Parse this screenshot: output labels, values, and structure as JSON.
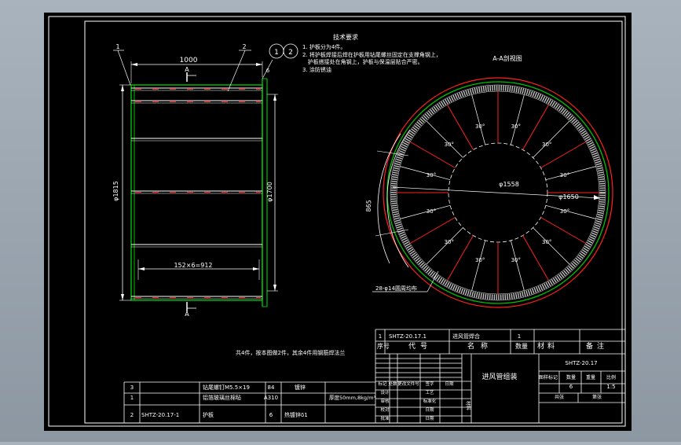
{
  "colors": {
    "background": "#9aa5b0",
    "sheet": "#000000",
    "line": "#ffffff",
    "shell": "#00c000",
    "hidden": "#ff2020",
    "insulation": "#c8c8c8"
  },
  "tech_requirements": {
    "heading": "技术要求",
    "lines": [
      "1. 护板分为4件。",
      "2. 将护板焊接后焊在护板用钻尾螺丝固定在支撑角钢上，",
      "   护板搭接处在角钢上，护板与保温层贴合严密。",
      "3. 涂防锈油"
    ]
  },
  "front_view": {
    "top_dim": "1000",
    "section_mark_top": "A",
    "section_mark_bottom": "A",
    "left_dim": "φ1815",
    "right_dim": "φ1700",
    "bottom_dim": "152×6=912",
    "leader_1": "1",
    "leader_2": "2",
    "leader_6": "6",
    "balloon_1": "1",
    "balloon_2": "2"
  },
  "section_view": {
    "title": "A-A剖视图",
    "inner_dia": "φ1558",
    "outer_dia": "φ1650",
    "arc_dim": "865",
    "holes_note": "28-φ14圆周均布",
    "angles": [
      "30°",
      "30°",
      "30°",
      "30°",
      "30°",
      "30°",
      "30°",
      "30°",
      "30°",
      "30°",
      "30°",
      "30°"
    ]
  },
  "note": "共4件，按本图做2件，其余4件用钢筋焊法兰",
  "bom": {
    "rows": [
      {
        "idx": "3",
        "code": "",
        "name": "钻尾螺钉M5.5×19",
        "qty": "84",
        "material": "镀锌",
        "mass": "",
        "remark": ""
      },
      {
        "idx": "1",
        "code": "",
        "name": "铝箔玻璃丝棉毡",
        "qty": "A310",
        "material": "",
        "mass": "厚度50mm,8kg/m³",
        "remark": ""
      },
      {
        "idx": "2",
        "code": "SHTZ-20.17-1",
        "name": "护板",
        "qty": "6",
        "material": "热镀锌δ1",
        "mass": "",
        "remark": ""
      }
    ],
    "top_row": {
      "idx": "1",
      "code": "SHTZ-20.17.1",
      "name": "进风管焊合",
      "qty": "1"
    },
    "header": {
      "idx": "序号",
      "code": "代号",
      "name": "名称",
      "qty": "数量",
      "material": "材料",
      "remark": "备注"
    }
  },
  "title_block": {
    "drawing_no": "SHTZ-20.17",
    "title": "进风管组装",
    "stage_label": "图样标记",
    "mass_label": "数量",
    "weight_label": "重量",
    "scale_label": "比例",
    "qty_value": "6",
    "scale_value": "1:5",
    "sheet_total": "共张",
    "sheet_label": "第张",
    "material_label": "材料",
    "sign_rows": [
      "标记",
      "处数",
      "更改文件号",
      "签字",
      "日期"
    ],
    "roles": [
      "设计",
      "审核",
      "校对",
      "批准"
    ],
    "roles_right": [
      "工艺",
      "标准化",
      "日期",
      "日期"
    ]
  }
}
